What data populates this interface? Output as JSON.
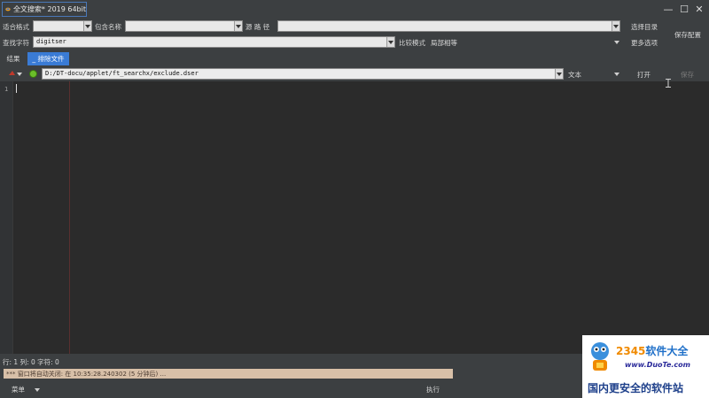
{
  "window": {
    "title": "全文搜索* 2019 64bit",
    "minimize": "—",
    "maximize": "☐",
    "close": "✕"
  },
  "toolbar": {
    "format_label": "适合格式",
    "include_name_label": "包含名称",
    "source_path_label": "源 路 径",
    "select_dir_button": "选择目录",
    "save_config_button": "保存配置",
    "search_string_label": "查找字符",
    "search_value": "digitser",
    "compare_mode_label": "比较模式",
    "compare_mode_value": "局部相等",
    "more_options_button": "更多选项"
  },
  "tabs": [
    {
      "label": "结果"
    },
    {
      "label": "_ 排除文件"
    }
  ],
  "pathbar": {
    "path": "D:/DT-docu/applet/ft_searchx/exclude.dser",
    "mode_value": "文本",
    "open_button": "打开",
    "save_button": "保存"
  },
  "editor": {
    "line_number": "1"
  },
  "status": {
    "text": "行: 1  列: 0  字符: 0"
  },
  "log": {
    "text": "*** 窗口将自动关闭: 在 10:35:28.240302 (5 分钟后) ..."
  },
  "bottom": {
    "menu_label": "菜单",
    "execute_label": "执行"
  },
  "watermark": {
    "brand_num": "2345",
    "brand_cn": "软件大全",
    "url": "www.DuoTe.com",
    "slogan": "国内更安全的软件站"
  },
  "colors": {
    "accent": "#3a7bd5",
    "panel": "#3c3f41",
    "editor_bg": "#2b2b2b",
    "log_strip": "#d8c0a8"
  }
}
